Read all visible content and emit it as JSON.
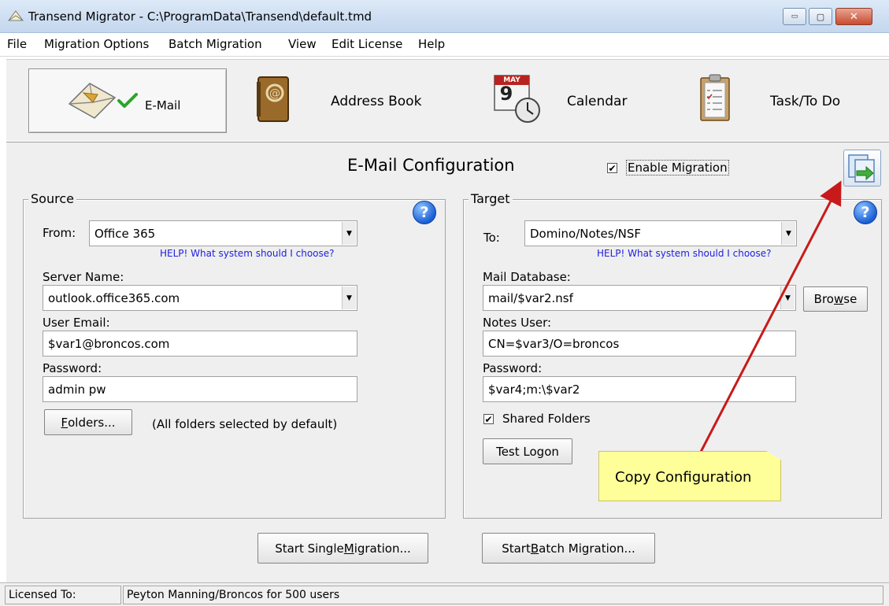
{
  "window": {
    "title": "Transend Migrator - C:\\ProgramData\\Transend\\default.tmd",
    "minimize_glyph": "▭",
    "maximize_glyph": "▢",
    "close_glyph": "✕"
  },
  "menu": [
    "File",
    "Migration Options",
    "Batch Migration",
    "View",
    "Edit License",
    "Help"
  ],
  "modules": {
    "email": "E-Mail",
    "address_book": "Address Book",
    "calendar": "Calendar",
    "calendar_month": "MAY",
    "calendar_day": "9",
    "task": "Task/To Do"
  },
  "config": {
    "title": "E-Mail Configuration",
    "enable_migration_label": "Enable Migration",
    "enable_migration_checked": true
  },
  "source": {
    "group_label": "Source",
    "from_label": "From:",
    "from_value": "Office 365",
    "help_link": "HELP! What system should I choose?",
    "server_label": "Server Name:",
    "server_value": "outlook.office365.com",
    "user_email_label": "User Email:",
    "user_email_value": "$var1@broncos.com",
    "password_label": "Password:",
    "password_value": "admin pw",
    "folders_button_pre": "",
    "folders_button_key": "F",
    "folders_button_post": "olders...",
    "folders_note": "(All folders selected by default)"
  },
  "target": {
    "group_label": "Target",
    "to_label": "To:",
    "to_value": "Domino/Notes/NSF",
    "help_link": "HELP! What system should I choose?",
    "mail_db_label": "Mail Database:",
    "mail_db_value": "mail/$var2.nsf",
    "browse_pre": "Bro",
    "browse_key": "w",
    "browse_post": "se",
    "notes_user_label": "Notes User:",
    "notes_user_value": "CN=$var3/O=broncos",
    "password_label": "Password:",
    "password_value": "$var4;m:\\$var2",
    "shared_folders_label": "Shared Folders",
    "shared_folders_checked": true,
    "test_logon_label": "Test Logon"
  },
  "actions": {
    "single_pre": "Start Single ",
    "single_key": "M",
    "single_post": "igration...",
    "batch_pre": "Start ",
    "batch_key": "B",
    "batch_post": "atch Migration..."
  },
  "annotation": {
    "callout_text": "Copy Configuration",
    "arrow_color": "#c81a1a",
    "note_color": "#ffff99"
  },
  "status": {
    "licensed_label": "Licensed To:",
    "licensed_value": "Peyton Manning/Broncos for 500 users"
  },
  "icons": {
    "help": "?",
    "check": "✔",
    "combo_arrow": "▼",
    "app": "envelope-icon",
    "copy_config": "copy-configuration-icon"
  }
}
